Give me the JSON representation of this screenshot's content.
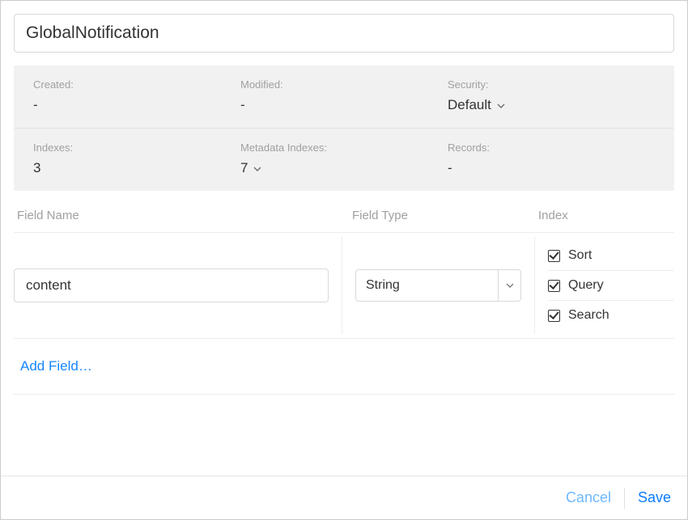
{
  "title": "GlobalNotification",
  "meta": {
    "created_label": "Created:",
    "created_value": "-",
    "modified_label": "Modified:",
    "modified_value": "-",
    "security_label": "Security:",
    "security_value": "Default",
    "indexes_label": "Indexes:",
    "indexes_value": "3",
    "metaindexes_label": "Metadata Indexes:",
    "metaindexes_value": "7",
    "records_label": "Records:",
    "records_value": "-"
  },
  "columns": {
    "name": "Field Name",
    "type": "Field Type",
    "index": "Index"
  },
  "field": {
    "name": "content",
    "type": "String",
    "sort_label": "Sort",
    "query_label": "Query",
    "search_label": "Search"
  },
  "add_field_label": "Add Field…",
  "footer": {
    "cancel": "Cancel",
    "save": "Save"
  }
}
